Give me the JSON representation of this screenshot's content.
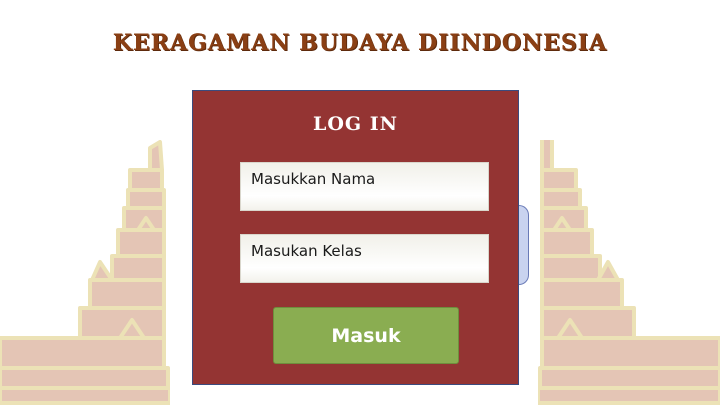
{
  "page": {
    "title": "KERAGAMAN BUDAYA DIINDONESIA"
  },
  "login": {
    "heading": "LOG IN",
    "name_field": "Masukkan Nama",
    "class_field": "Masukan Kelas",
    "submit_label": "Masuk"
  },
  "colors": {
    "title": "#8a3f14",
    "panel": "#943433",
    "button": "#8aad51",
    "gate_fill": "#e4c5b5",
    "gate_outline": "#ece2b6"
  },
  "decorations": {
    "left": "candi-bentar-gate-left",
    "right": "candi-bentar-gate-right"
  }
}
